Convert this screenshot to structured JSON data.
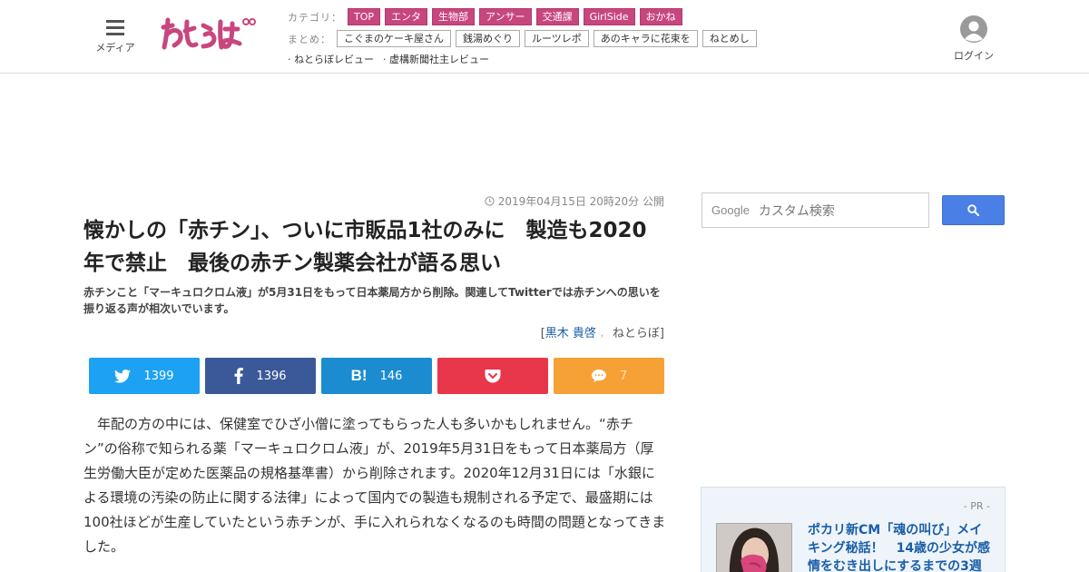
{
  "header": {
    "menu_label": "メディア",
    "login_label": "ログイン",
    "category_label": "カテゴリ：",
    "categories": [
      "TOP",
      "エンタ",
      "生物部",
      "アンサー",
      "交通課",
      "GirlSide",
      "おかね"
    ],
    "summary_label": "まとめ：",
    "summaries": [
      "こぐまのケーキ屋さん",
      "銭湯めぐり",
      "ルーツレポ",
      "あのキャラに花束を",
      "ねとめし"
    ],
    "reviews": [
      "· ねとらぼレビュー",
      "· 虚構新聞社主レビュー"
    ]
  },
  "article": {
    "date": "2019年04月15日 20時20分 公開",
    "title": "懐かしの「赤チン」、ついに市販品1社のみに　製造も2020年で禁止　最後の赤チン製薬会社が語る思い",
    "subtitle": "赤チンこと「マーキュロクロム液」が5月31日をもって日本薬局方から削除。関連してTwitterでは赤チンへの思いを振り返る声が相次いでいます。",
    "byline_open": "[",
    "author": "黒木 貴啓",
    "byline_sep": "，",
    "publisher": "ねとらぼ",
    "byline_close": "]",
    "body": "年配の方の中には、保健室でひざ小僧に塗ってもらった人も多いかもしれません。“赤チン”の俗称で知られる薬「マーキュロクロム液」が、2019年5月31日をもって日本薬局方（厚生労働大臣が定めた医薬品の規格基準書）から削除されます。2020年12月31日には「水銀による環境の汚染の防止に関する法律」によって国内での製造も規制される予定で、最盛期には100社ほどが生産していたという赤チンが、手に入れられなくなるのも時間の問題となってきました。"
  },
  "share": {
    "twitter_count": "1399",
    "facebook_count": "1396",
    "hatena_glyph": "B!",
    "hatena_count": "146",
    "comment_count": "7"
  },
  "sidebar": {
    "search_brand": "Google",
    "search_placeholder": "カスタム検索",
    "pr_label": "- PR -",
    "pr_title": "ポカリ新CM「魂の叫び」メイキング秘話！　14歳の少女が感情をむき出しにするまでの3週"
  },
  "colors": {
    "category_tag": "#c8467e",
    "twitter": "#1da1f2",
    "facebook": "#3b5998",
    "hatena": "#1b8ccf",
    "pocket": "#e8364b",
    "comment": "#f6a135",
    "search_button": "#4a80e6",
    "link": "#1a5ea8"
  }
}
